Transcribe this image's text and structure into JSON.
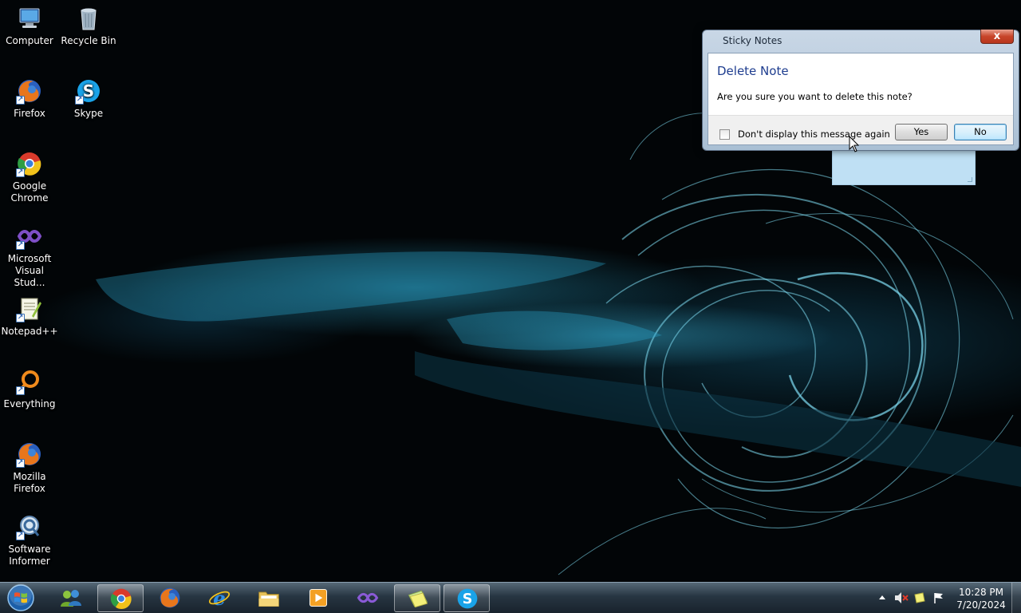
{
  "desktop": {
    "icons": [
      {
        "label": "Computer",
        "icon": "computer-icon"
      },
      {
        "label": "Recycle Bin",
        "icon": "recycle-bin-icon"
      },
      {
        "label": "Firefox",
        "icon": "firefox-icon"
      },
      {
        "label": "Skype",
        "icon": "skype-icon"
      },
      {
        "label": "Google Chrome",
        "icon": "chrome-icon"
      },
      {
        "label": "Microsoft Visual Stud...",
        "icon": "visual-studio-icon"
      },
      {
        "label": "Notepad++",
        "icon": "notepadpp-icon"
      },
      {
        "label": "Everything",
        "icon": "everything-icon"
      },
      {
        "label": "Mozilla Firefox",
        "icon": "firefox-icon"
      },
      {
        "label": "Software Informer",
        "icon": "software-informer-icon"
      }
    ]
  },
  "dialog": {
    "window_title": "Sticky Notes",
    "close_label": "x",
    "heading": "Delete Note",
    "message": "Are you sure you want to delete this note?",
    "checkbox_label": "Don't display this message again",
    "checkbox_checked": false,
    "yes_label": "Yes",
    "no_label": "No"
  },
  "taskbar": {
    "items": [
      {
        "name": "Google Chrome",
        "icon": "chrome-icon",
        "active": true
      },
      {
        "name": "Firefox",
        "icon": "firefox-icon",
        "active": false
      },
      {
        "name": "Internet Explorer",
        "icon": "internet-explorer-icon",
        "active": false
      },
      {
        "name": "Windows Explorer",
        "icon": "folder-icon",
        "active": false
      },
      {
        "name": "Media Player",
        "icon": "media-player-icon",
        "active": false
      },
      {
        "name": "Visual Studio",
        "icon": "visual-studio-icon",
        "active": false
      },
      {
        "name": "Sticky Notes",
        "icon": "sticky-notes-icon",
        "active": true
      },
      {
        "name": "Skype",
        "icon": "skype-icon",
        "active": true
      }
    ],
    "clock_time": "10:28 PM",
    "clock_date": "7/20/2024"
  },
  "colors": {
    "dialog_heading": "#1e3d8f",
    "close_button": "#c8452b",
    "sticky_note": "#bfe0f4",
    "wallpaper_accent": "#3cb4d7"
  }
}
